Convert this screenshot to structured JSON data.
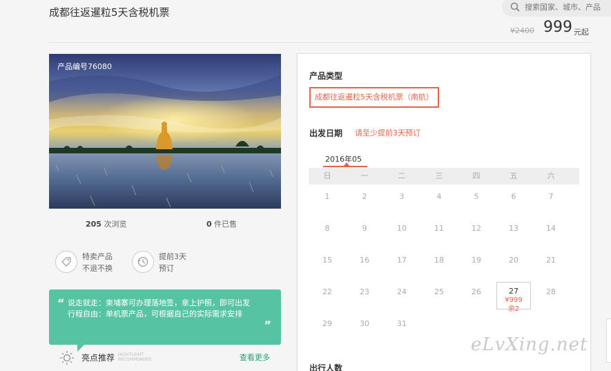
{
  "header": {
    "title": "成都往返暹粒5天含税机票",
    "search_placeholder": "搜索国家、城市、产品",
    "old_price": "¥2400",
    "price": "999",
    "price_unit": "元起"
  },
  "product": {
    "number": "产品编号76080",
    "views_count": "205",
    "views_label": "次浏览",
    "sold_count": "0",
    "sold_label": "件已售"
  },
  "features": [
    {
      "icon": "tag-icon",
      "line1": "特卖产品",
      "line2": "不退不换"
    },
    {
      "icon": "clock-icon",
      "line1": "提前3天",
      "line2": "预订"
    }
  ],
  "highlight": {
    "quote_line1": "说走就走：柬埔寨可办理落地签，拿上护照，即可出发",
    "quote_line2": "行程自由：单机票产品，可根据自己的实际需求安排",
    "label": "亮点推荐",
    "sub1": "HIGHTLIGHT",
    "sub2": "RECOMMENDED",
    "more": "查看更多"
  },
  "booking": {
    "type_title": "产品类型",
    "type_option": "成都往返暹粒5天含税机票（南航）",
    "date_title": "出发日期",
    "date_hint": "请至少提前3天预订",
    "month": "2016年05",
    "weekdays": [
      "日",
      "一",
      "二",
      "三",
      "四",
      "五",
      "六"
    ],
    "days": [
      "1",
      "2",
      "3",
      "4",
      "5",
      "6",
      "7",
      "8",
      "9",
      "10",
      "11",
      "12",
      "13",
      "14",
      "15",
      "16",
      "17",
      "18",
      "19",
      "20",
      "21",
      "22",
      "23",
      "24",
      "25",
      "26",
      "27",
      "28",
      "29",
      "30",
      "31"
    ],
    "selected_day": "27",
    "selected_price": "¥999",
    "selected_remain": "余2",
    "travelers_title": "出行人数"
  },
  "watermark": "eLvXing.net",
  "colors": {
    "accent": "#e0664a",
    "green": "#56c4a3",
    "link_green": "#2e9e76"
  }
}
